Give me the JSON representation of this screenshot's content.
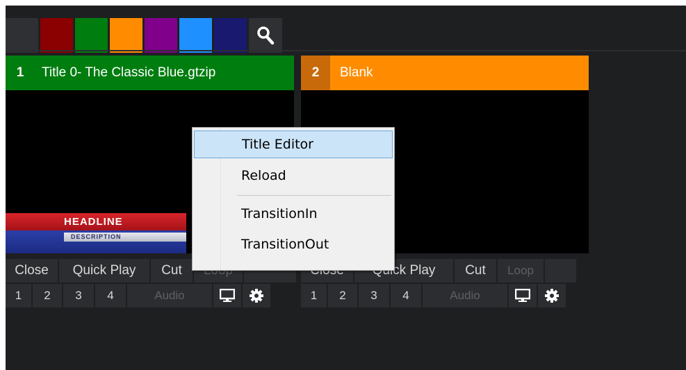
{
  "palette": {
    "swatches": [
      {
        "name": "slate",
        "color": "#2f3033"
      },
      {
        "name": "red",
        "color": "#8b0000"
      },
      {
        "name": "green",
        "color": "#007d0f"
      },
      {
        "name": "orange",
        "color": "#ff8c00"
      },
      {
        "name": "purple",
        "color": "#80008b"
      },
      {
        "name": "blue",
        "color": "#1e90ff"
      },
      {
        "name": "navy",
        "color": "#191970"
      }
    ],
    "search_icon": "search-icon"
  },
  "inputs": [
    {
      "number": "1",
      "title": "Title 0- The Classic Blue.gtzip",
      "header_color": "#007d0f",
      "number_bg": "#007d0f",
      "lower_third": {
        "headline": "HEADLINE",
        "description": "DESCRIPTION"
      },
      "controls": {
        "close": "Close",
        "quick_play": "Quick Play",
        "cut": "Cut",
        "loop": "Loop",
        "overlays": [
          "1",
          "2",
          "3",
          "4"
        ],
        "audio": "Audio"
      }
    },
    {
      "number": "2",
      "title": "Blank",
      "header_color": "#ff8c00",
      "number_bg": "#c96a0a",
      "controls": {
        "close": "Close",
        "quick_play": "Quick Play",
        "cut": "Cut",
        "loop": "Loop",
        "overlays": [
          "1",
          "2",
          "3",
          "4"
        ],
        "audio": "Audio"
      }
    }
  ],
  "context_menu": {
    "items": [
      "Title Editor",
      "Reload",
      "TransitionIn",
      "TransitionOut"
    ],
    "selected": "Title Editor"
  },
  "icons": {
    "output": "monitor-icon",
    "settings": "gear-icon"
  }
}
